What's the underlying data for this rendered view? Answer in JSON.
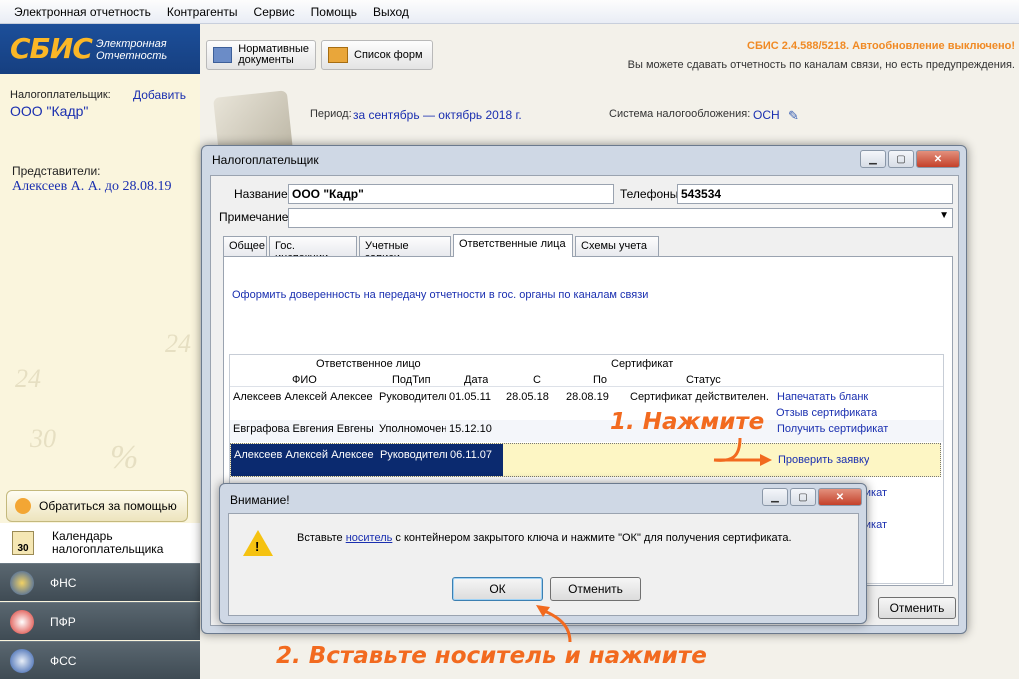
{
  "menu": [
    "Электронная отчетность",
    "Контрагенты",
    "Сервис",
    "Помощь",
    "Выход"
  ],
  "sidebar": {
    "logo": "СБИС",
    "logo_sub1": "Электронная",
    "logo_sub2": "Отчетность",
    "taxpayer_label": "Налогоплательщик:",
    "add_link": "Добавить",
    "taxpayer_name": "ООО \"Кадр\"",
    "reps_label": "Представители:",
    "rep_name": "Алексеев А. А. до 28.08.19",
    "help_button": "Обратиться за помощью",
    "calendar_label1": "Календарь",
    "calendar_label2": "налогоплательщика",
    "calendar_day": "30",
    "nav": [
      "ФНС",
      "ПФР",
      "ФСС"
    ]
  },
  "toolbar": {
    "normdocs1": "Нормативные",
    "normdocs2": "документы",
    "forms": "Список форм"
  },
  "status": {
    "version": "СБИС 2.4.588/5218. Автообновление выключено!",
    "warning": "Вы можете сдавать отчетность по каналам связи, но есть предупреждения."
  },
  "period": {
    "label": "Период:",
    "value": "за сентябрь — октябрь 2018 г.",
    "tax_label": "Система налогообложения:",
    "tax_value": "ОСН"
  },
  "dialog": {
    "title": "Налогоплательщик",
    "name_label": "Название",
    "name_value": "ООО \"Кадр\"",
    "phones_label": "Телефоны",
    "phones_value": "543534",
    "note_label": "Примечание",
    "tabs": [
      "Общее",
      "Гос. инспекции",
      "Учетные записи",
      "Ответственные лица",
      "Схемы учета"
    ],
    "proxy_link": "Оформить доверенность на передачу отчетности в гос. органы по каналам связи",
    "grid": {
      "group1": "Ответственное лицо",
      "group2": "Сертификат",
      "headers": [
        "ФИО",
        "ПодТип",
        "Дата",
        "С",
        "По",
        "Статус"
      ],
      "rows": [
        {
          "fio": "Алексеев Алексей Алексее",
          "type": "Руководитель",
          "date": "01.05.11",
          "from": "28.05.18",
          "to": "28.08.19",
          "status": "Сертификат действителен.",
          "actions": [
            "Напечатать бланк",
            "Отзыв сертификата"
          ]
        },
        {
          "fio": "Евграфова Евгения Евгены",
          "type": "Уполномоченный",
          "date": "15.12.10",
          "from": "",
          "to": "",
          "status": "",
          "actions": [
            "Получить сертификат"
          ]
        },
        {
          "fio": "Алексеев Алексей Алексее",
          "type": "Руководитель",
          "date": "06.11.07",
          "from": "",
          "to": "",
          "status": "",
          "actions": [
            "Проверить заявку"
          ]
        }
      ],
      "hidden_actions": [
        "Получить сертификат",
        "Получить сертификат"
      ]
    },
    "cancel": "Отменить"
  },
  "alert": {
    "title": "Внимание!",
    "text_before": "Вставьте ",
    "text_link": "носитель",
    "text_after": " с контейнером закрытого ключа и нажмите \"ОК\" для получения сертификата.",
    "ok": "ОК",
    "cancel": "Отменить"
  },
  "annotations": {
    "step1": "1. Нажмите",
    "step2": "2. Вставьте носитель и нажмите"
  },
  "colors": {
    "brand_blue": "#1c4f9a",
    "accent_orange": "#f26a1f",
    "link_blue": "#1a2fb0",
    "selected_row": "#0b2a6f",
    "highlight_row": "#fdf6c4"
  }
}
